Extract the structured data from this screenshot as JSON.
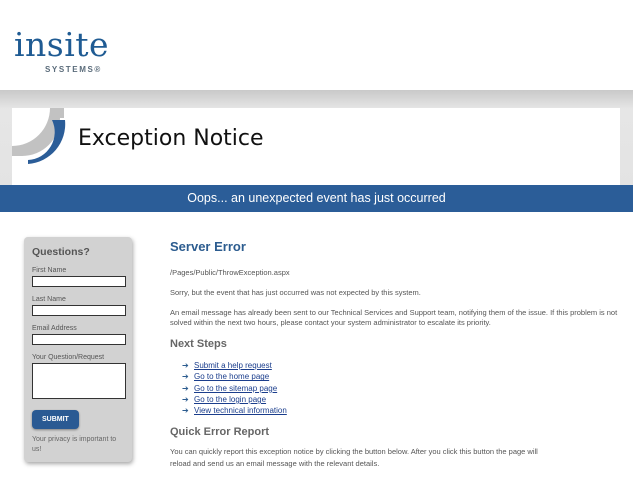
{
  "logo": {
    "main": "insite",
    "sub": "SYSTEMS®"
  },
  "header": {
    "title": "Exception Notice"
  },
  "banner": "Oops... an unexpected event has just occurred",
  "sidebar": {
    "title": "Questions?",
    "first_name_label": "First Name",
    "last_name_label": "Last Name",
    "email_label": "Email Address",
    "question_label": "Your Question/Request",
    "submit_label": "SUBMIT",
    "privacy": "Your privacy is important to us!"
  },
  "main": {
    "heading": "Server Error",
    "path": "/Pages/Public/ThrowException.aspx",
    "para1": "Sorry, but the event that has just occurred was not expected by this system.",
    "para2": "An email message has already been sent to our Technical Services and Support team, notifying them of the issue. If this problem is not solved within the next two hours, please contact your system administrator to escalate its priority.",
    "next_steps_heading": "Next Steps",
    "steps": [
      "Submit a help request",
      "Go to the home page",
      "Go to the sitemap page",
      "Go to the login page",
      "View technical information"
    ],
    "report_heading": "Quick Error Report",
    "report_text": "You can quickly report this exception notice by clicking the button below. After you click this button the page will",
    "report_text2": "reload and send us an email message with the relevant details."
  },
  "colors": {
    "brand_blue": "#2b5d98",
    "link": "#1a3d8c"
  }
}
